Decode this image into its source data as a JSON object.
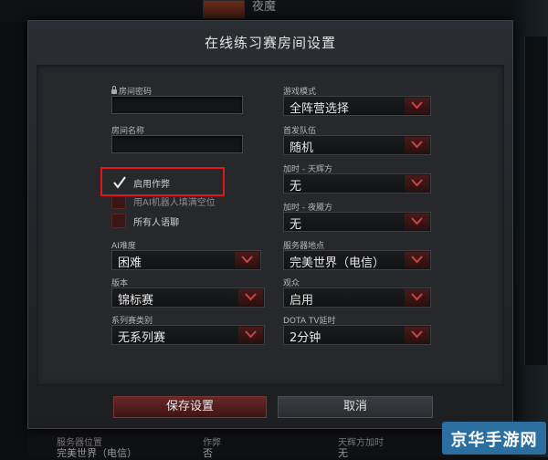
{
  "background": {
    "top_name": "夜魔",
    "bottom_left_line1": "服务器位置",
    "bottom_left_line2": "完美世界（电信）",
    "bottom_mid_line1": "作弊",
    "bottom_mid_line2": "否",
    "bottom_right_line1": "天辉方加时",
    "bottom_right_line2": "无"
  },
  "dialog": {
    "title": "在线练习赛房间设置",
    "left": {
      "password_label": "房间密码",
      "password_value": "",
      "name_label": "房间名称",
      "name_value": "",
      "checkboxes": [
        {
          "label": "启用作弊",
          "checked": true
        },
        {
          "label": "用AI机器人填满空位",
          "checked": false
        },
        {
          "label": "所有人语聊",
          "checked": false
        }
      ],
      "difficulty_label": "AI难度",
      "difficulty_value": "困难",
      "version_label": "版本",
      "version_value": "锦标赛",
      "series_label": "系列赛类别",
      "series_value": "无系列赛"
    },
    "right": {
      "game_mode_label": "游戏模式",
      "game_mode_value": "全阵营选择",
      "first_team_label": "首发队伍",
      "first_team_value": "随机",
      "radiant_ot_label": "加时 - 天辉方",
      "radiant_ot_value": "无",
      "dire_ot_label": "加时 - 夜魇方",
      "dire_ot_value": "无",
      "server_label": "服务器地点",
      "server_value": "完美世界（电信）",
      "spectator_label": "观众",
      "spectator_value": "启用",
      "tv_delay_label": "DOTA TV延时",
      "tv_delay_value": "2分钟"
    },
    "save_label": "保存设置",
    "cancel_label": "取消"
  },
  "watermark": "京华手游网",
  "colors": {
    "highlight": "#e0161a",
    "dropdown_arrow": "#4a1a1a",
    "save_button": "#6a2626"
  }
}
